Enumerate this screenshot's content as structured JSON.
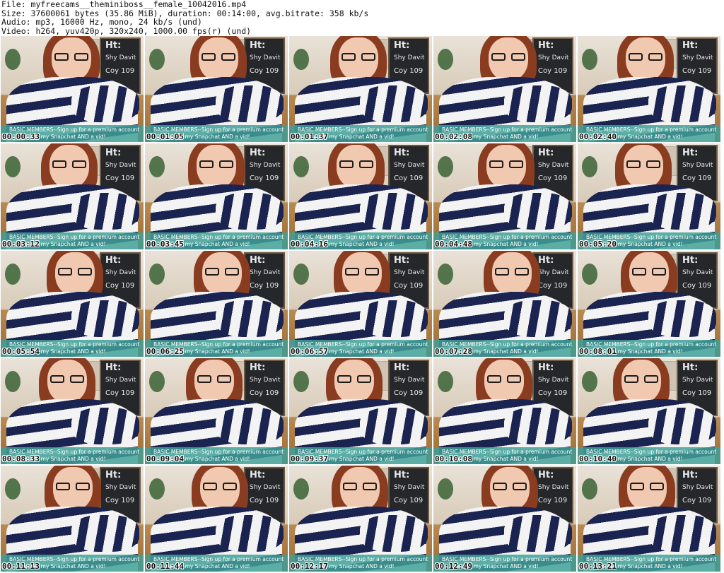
{
  "header": {
    "line1": "File: myfreecams__theminiboss__female_10042016.mp4",
    "line2": "Size: 37600061 bytes (35.86 MiB), duration: 00:14:00, avg.bitrate: 358 kb/s",
    "line3": "Audio: mp3, 16000 Hz, mono, 24 kb/s (und)",
    "line4": "Video: h264, yuv420p, 320x240, 1000.00 fps(r) (und)"
  },
  "banner": {
    "line1": "BASIC MEMBERS--Sign up for a premium account",
    "line2": "nd get my Snapchat AND a vid!"
  },
  "chalkboard": {
    "line1": "Ht:",
    "line2": "Shy Davit",
    "line3": "Coy 109"
  },
  "thumbnails": [
    {
      "time": "00:00:33"
    },
    {
      "time": "00:01:05"
    },
    {
      "time": "00:01:37"
    },
    {
      "time": "00:02:08"
    },
    {
      "time": "00:02:40"
    },
    {
      "time": "00:03:12"
    },
    {
      "time": "00:03:45"
    },
    {
      "time": "00:04:16"
    },
    {
      "time": "00:04:48"
    },
    {
      "time": "00:05:20"
    },
    {
      "time": "00:05:54"
    },
    {
      "time": "00:06:25"
    },
    {
      "time": "00:06:57"
    },
    {
      "time": "00:07:28"
    },
    {
      "time": "00:08:01"
    },
    {
      "time": "00:08:33"
    },
    {
      "time": "00:09:04"
    },
    {
      "time": "00:09:37"
    },
    {
      "time": "00:10:08"
    },
    {
      "time": "00:10:40"
    },
    {
      "time": "00:11:13"
    },
    {
      "time": "00:11:44"
    },
    {
      "time": "00:12:17"
    },
    {
      "time": "00:12:49"
    },
    {
      "time": "00:13:21"
    }
  ]
}
